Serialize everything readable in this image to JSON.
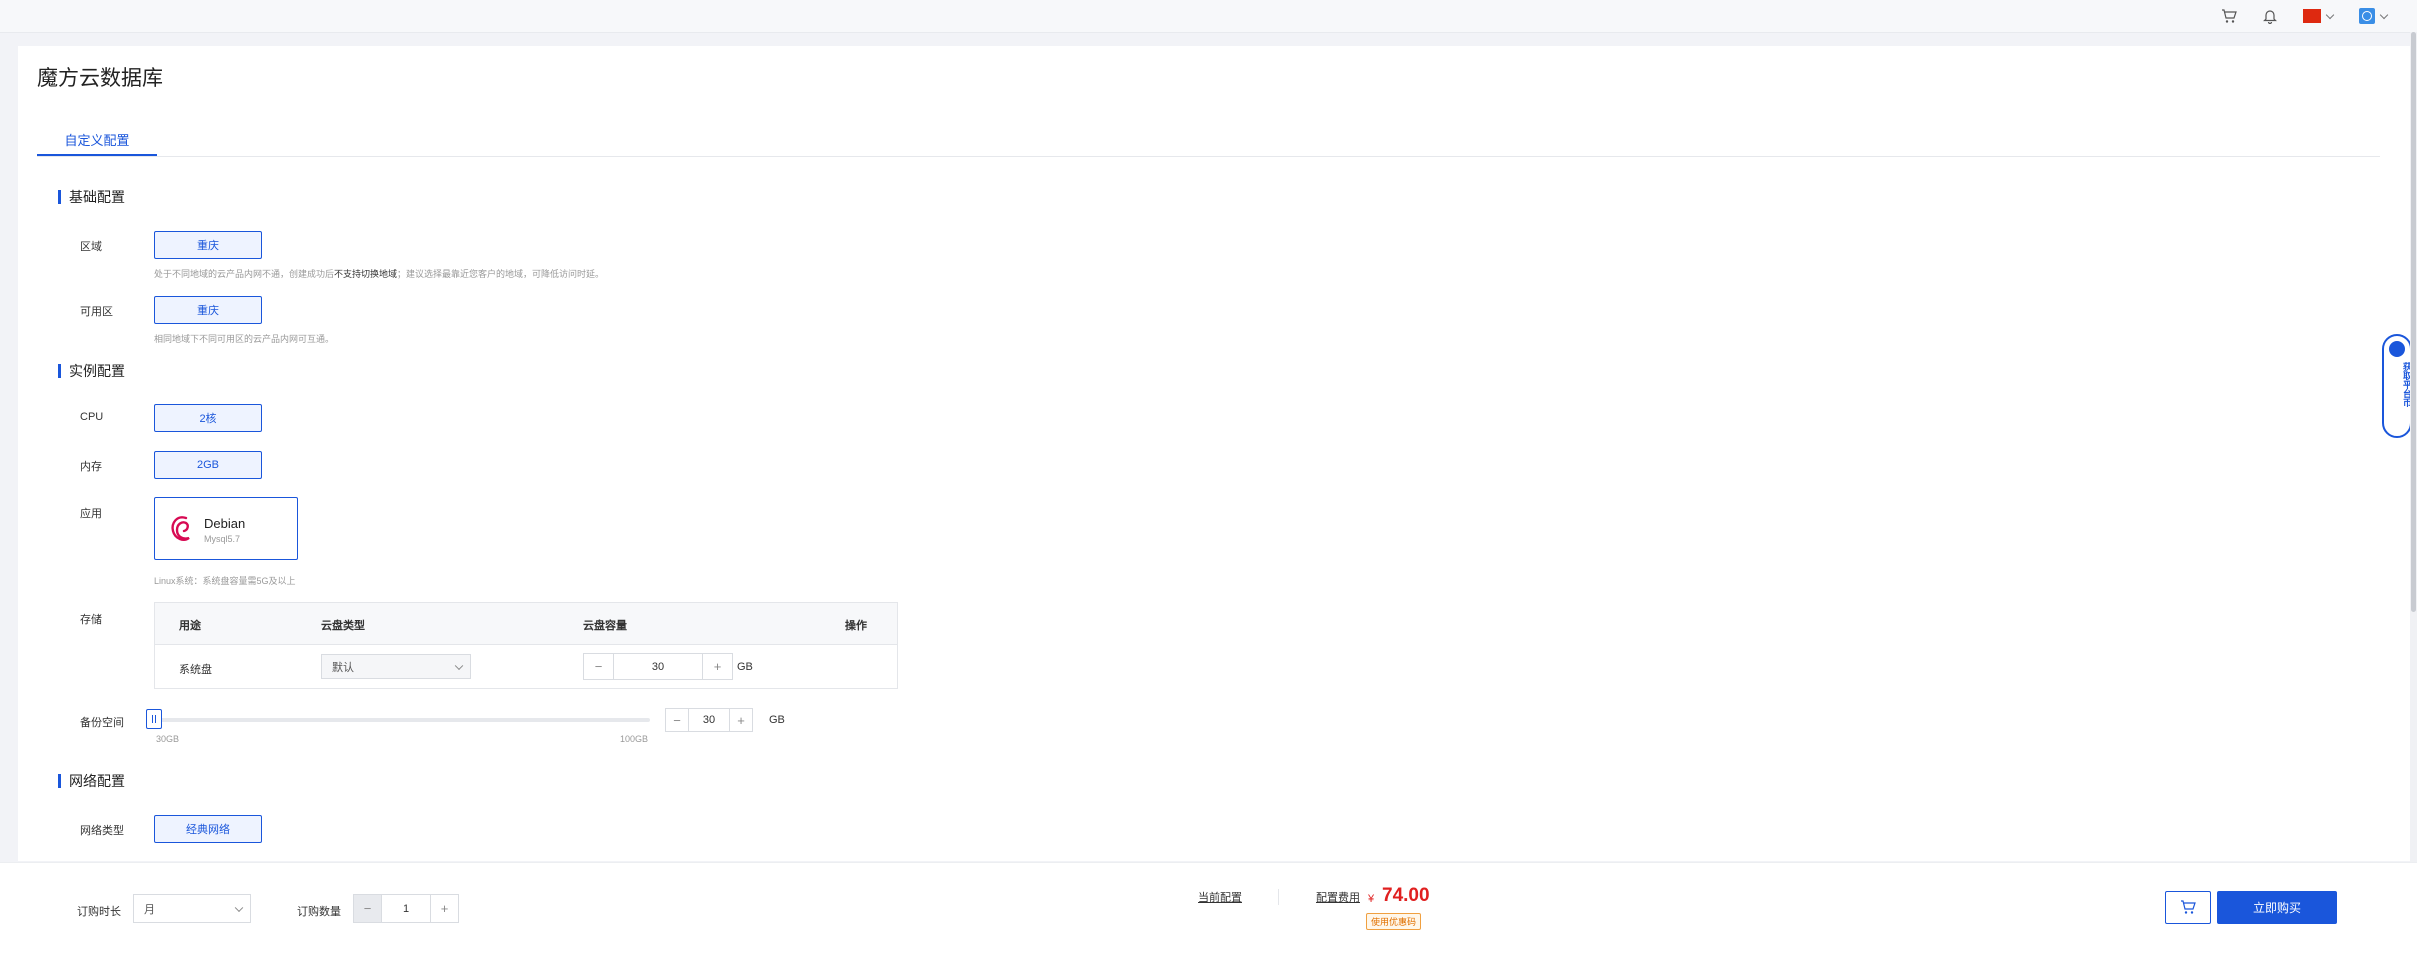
{
  "header": {
    "flag_color": "#de2910"
  },
  "page_title": "魔方云数据库",
  "tabs": [
    {
      "label": "自定义配置"
    }
  ],
  "sections": {
    "basic": "基础配置",
    "instance": "实例配置",
    "network": "网络配置"
  },
  "region": {
    "label": "区域",
    "value": "重庆",
    "hint_pre": "处于不同地域的云产品内网不通，创建成功后",
    "hint_bold": "不支持切换地域",
    "hint_post": "；建议选择最靠近您客户的地域，可降低访问时延。"
  },
  "zone": {
    "label": "可用区",
    "value": "重庆",
    "hint": "相同地域下不同可用区的云产品内网可互通。"
  },
  "cpu": {
    "label": "CPU",
    "value": "2核"
  },
  "memory": {
    "label": "内存",
    "value": "2GB"
  },
  "app": {
    "label": "应用",
    "name": "Debian",
    "version": "Mysql5.7",
    "hint": "Linux系统：系统盘容量需5G及以上"
  },
  "storage": {
    "label": "存储",
    "columns": [
      "用途",
      "云盘类型",
      "云盘容量",
      "操作"
    ],
    "rows": [
      {
        "usage": "系统盘",
        "type": "默认",
        "capacity": "30",
        "unit": "GB"
      }
    ]
  },
  "backup": {
    "label": "备份空间",
    "min": "30GB",
    "max": "100GB",
    "value": "30",
    "unit": "GB"
  },
  "network": {
    "type_label": "网络类型",
    "type_value": "经典网络"
  },
  "footer": {
    "duration_label": "订购时长",
    "duration_value": "月",
    "quantity_label": "订购数量",
    "quantity_value": "1",
    "current_config": "当前配置",
    "price_label": "配置费用",
    "currency": "¥",
    "price": "74.00",
    "coupon": "使用优惠码",
    "buy": "立即购买"
  },
  "float_tab": {
    "text": "获取平台币"
  },
  "colors": {
    "accent": "#1a56db",
    "price": "#e02020"
  }
}
